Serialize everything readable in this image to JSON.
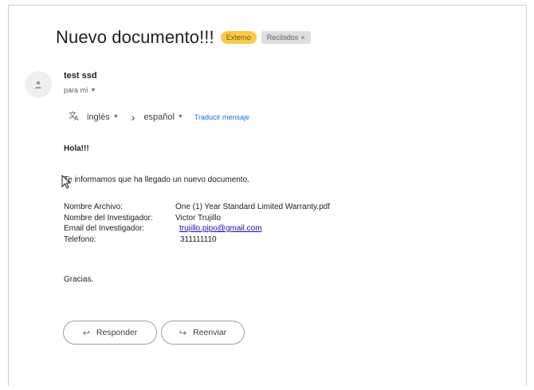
{
  "email": {
    "subject": "Nuevo documento!!!",
    "labels": {
      "external": "Externo",
      "inbox": "Recibidos",
      "inbox_remove": "×"
    },
    "sender_name": "test ssd",
    "recipient": "para mí",
    "translate": {
      "from": "inglés",
      "to": "español",
      "action": "Traducir mensaje"
    },
    "body": {
      "greeting": "Hola!!!",
      "intro": "Te informamos que ha llegado un nuevo documento.",
      "details": [
        {
          "key": "Nombre Archivo:",
          "value": "One (1) Year Standard Limited Warranty.pdf"
        },
        {
          "key": "Nombre del Investigador:",
          "value": "Victor Trujillo"
        },
        {
          "key": "Email del Investigador:",
          "value": "trujillo.pipo@gmail.com"
        },
        {
          "key": "Telefono:",
          "value": "311111110"
        }
      ],
      "closing": "Gracias."
    },
    "actions": {
      "reply": "Responder",
      "forward": "Reenviar"
    }
  },
  "colors": {
    "external_chip": "#f7c94b",
    "inbox_chip": "#dedede",
    "link": "#1a73e8"
  }
}
